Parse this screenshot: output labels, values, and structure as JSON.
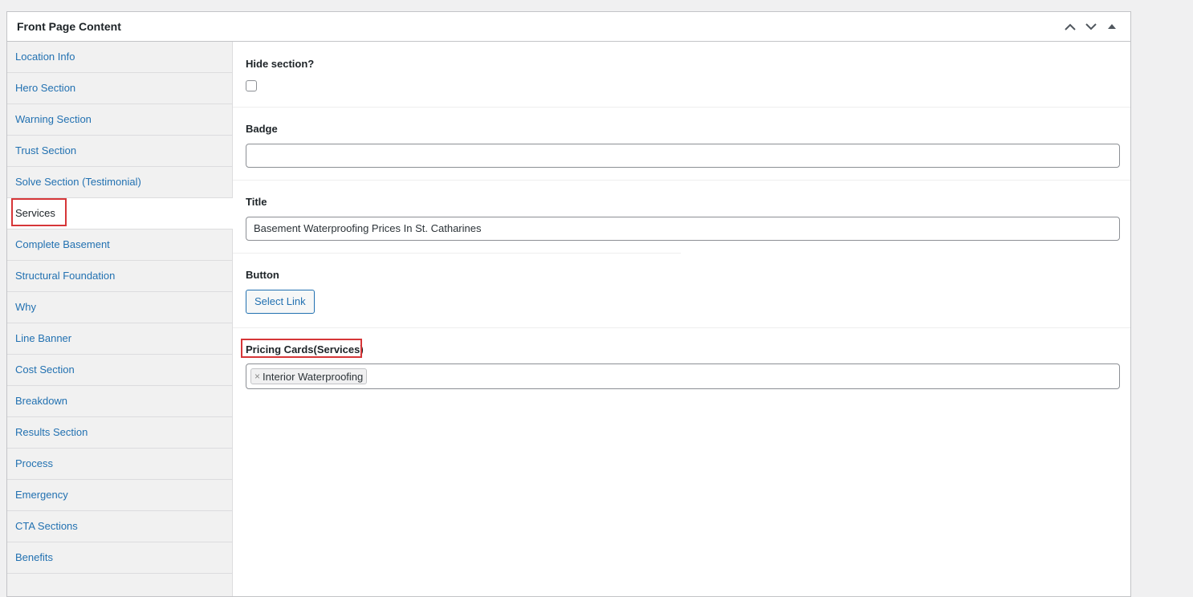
{
  "metabox": {
    "title": "Front Page Content"
  },
  "tabs": [
    {
      "label": "Location Info",
      "active": false
    },
    {
      "label": "Hero Section",
      "active": false
    },
    {
      "label": "Warning Section",
      "active": false
    },
    {
      "label": "Trust Section",
      "active": false
    },
    {
      "label": "Solve Section (Testimonial)",
      "active": false
    },
    {
      "label": "Services",
      "active": true
    },
    {
      "label": "Complete Basement",
      "active": false
    },
    {
      "label": "Structural Foundation",
      "active": false
    },
    {
      "label": "Why",
      "active": false
    },
    {
      "label": "Line Banner",
      "active": false
    },
    {
      "label": "Cost Section",
      "active": false
    },
    {
      "label": "Breakdown",
      "active": false
    },
    {
      "label": "Results Section",
      "active": false
    },
    {
      "label": "Process",
      "active": false
    },
    {
      "label": "Emergency",
      "active": false
    },
    {
      "label": "CTA Sections",
      "active": false
    },
    {
      "label": "Benefits",
      "active": false
    }
  ],
  "fields": {
    "hide_section": {
      "label": "Hide section?",
      "checked": false
    },
    "badge": {
      "label": "Badge",
      "value": ""
    },
    "title": {
      "label": "Title",
      "value": "Basement Waterproofing Prices In St. Catharines"
    },
    "button": {
      "label": "Button",
      "action_label": "Select Link"
    },
    "pricing_cards": {
      "label": "Pricing Cards(Services)",
      "selected": [
        {
          "label": "Interior Waterproofing",
          "remove_glyph": "×"
        }
      ]
    }
  },
  "colors": {
    "link": "#2271b1",
    "highlight": "#d63638",
    "text": "#1d2327"
  },
  "icons": {
    "move_up": "chevron-up-icon",
    "move_down": "chevron-down-icon",
    "toggle": "triangle-up-icon"
  }
}
